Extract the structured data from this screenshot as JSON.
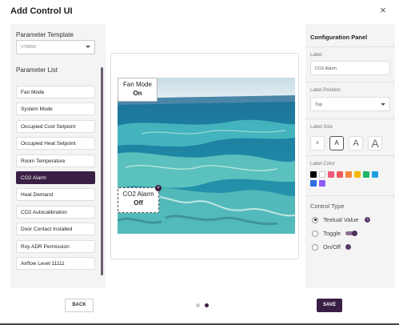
{
  "dialog": {
    "title": "Add Control UI",
    "close_glyph": "×"
  },
  "left": {
    "template_label": "Parameter Template",
    "template_value": "VT8650",
    "list_label": "Parameter List",
    "items": [
      "Fan Mode",
      "System Mode",
      "Occupied Cool Setpoint",
      "Occupied Heat Setpoint",
      "Room Temperature",
      "CO2 Alarm",
      "Heat Demand",
      "CO2 Autocalibration",
      "Door Contact Installed",
      "Roy ADR Permission",
      "Airflow Level 11111"
    ],
    "active_index": 5
  },
  "canvas": {
    "controls": [
      {
        "label": "Fan Mode",
        "value": "On"
      },
      {
        "label": "CO2 Alarm",
        "value": "Off"
      }
    ]
  },
  "config": {
    "title": "Configuration Panel",
    "label_field": "Label",
    "label_value": "CO2 Alarm",
    "position_field": "Label Position",
    "position_value": "Top",
    "size_field": "Label Size",
    "sizes": [
      "A",
      "A",
      "A",
      "A"
    ],
    "color_field": "Label Color",
    "colors": [
      "#000000",
      "#ffffff",
      "#f0597a",
      "#f05a5a",
      "#f5873c",
      "#f5b800",
      "#1db56d",
      "#1ea0e0",
      "#2d6fe8",
      "#8b5cf6"
    ],
    "control_type_field": "Control Type",
    "control_types": [
      "Textual Value",
      "Toggle",
      "On/Off"
    ],
    "info_glyph": "i",
    "accent": "#3a1f44"
  },
  "footer": {
    "back": "BACK",
    "save": "SAVE"
  }
}
